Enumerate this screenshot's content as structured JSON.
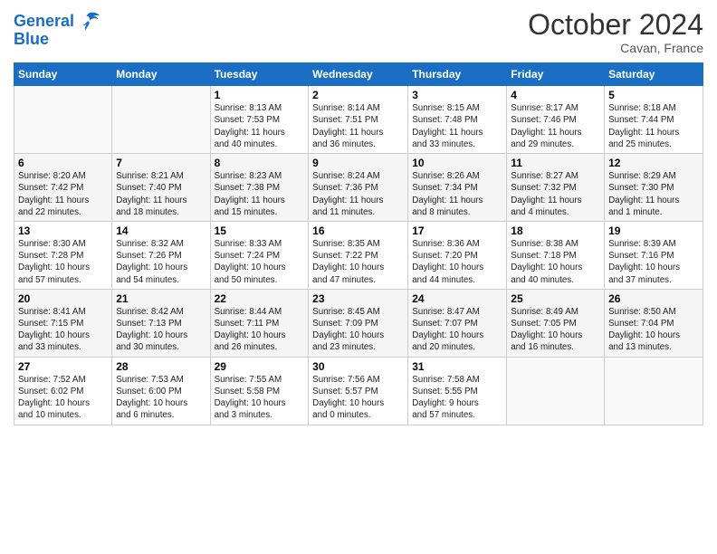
{
  "header": {
    "logo_line1": "General",
    "logo_line2": "Blue",
    "month": "October 2024",
    "location": "Cavan, France"
  },
  "weekdays": [
    "Sunday",
    "Monday",
    "Tuesday",
    "Wednesday",
    "Thursday",
    "Friday",
    "Saturday"
  ],
  "weeks": [
    [
      {
        "day": "",
        "detail": ""
      },
      {
        "day": "",
        "detail": ""
      },
      {
        "day": "1",
        "detail": "Sunrise: 8:13 AM\nSunset: 7:53 PM\nDaylight: 11 hours\nand 40 minutes."
      },
      {
        "day": "2",
        "detail": "Sunrise: 8:14 AM\nSunset: 7:51 PM\nDaylight: 11 hours\nand 36 minutes."
      },
      {
        "day": "3",
        "detail": "Sunrise: 8:15 AM\nSunset: 7:48 PM\nDaylight: 11 hours\nand 33 minutes."
      },
      {
        "day": "4",
        "detail": "Sunrise: 8:17 AM\nSunset: 7:46 PM\nDaylight: 11 hours\nand 29 minutes."
      },
      {
        "day": "5",
        "detail": "Sunrise: 8:18 AM\nSunset: 7:44 PM\nDaylight: 11 hours\nand 25 minutes."
      }
    ],
    [
      {
        "day": "6",
        "detail": "Sunrise: 8:20 AM\nSunset: 7:42 PM\nDaylight: 11 hours\nand 22 minutes."
      },
      {
        "day": "7",
        "detail": "Sunrise: 8:21 AM\nSunset: 7:40 PM\nDaylight: 11 hours\nand 18 minutes."
      },
      {
        "day": "8",
        "detail": "Sunrise: 8:23 AM\nSunset: 7:38 PM\nDaylight: 11 hours\nand 15 minutes."
      },
      {
        "day": "9",
        "detail": "Sunrise: 8:24 AM\nSunset: 7:36 PM\nDaylight: 11 hours\nand 11 minutes."
      },
      {
        "day": "10",
        "detail": "Sunrise: 8:26 AM\nSunset: 7:34 PM\nDaylight: 11 hours\nand 8 minutes."
      },
      {
        "day": "11",
        "detail": "Sunrise: 8:27 AM\nSunset: 7:32 PM\nDaylight: 11 hours\nand 4 minutes."
      },
      {
        "day": "12",
        "detail": "Sunrise: 8:29 AM\nSunset: 7:30 PM\nDaylight: 11 hours\nand 1 minute."
      }
    ],
    [
      {
        "day": "13",
        "detail": "Sunrise: 8:30 AM\nSunset: 7:28 PM\nDaylight: 10 hours\nand 57 minutes."
      },
      {
        "day": "14",
        "detail": "Sunrise: 8:32 AM\nSunset: 7:26 PM\nDaylight: 10 hours\nand 54 minutes."
      },
      {
        "day": "15",
        "detail": "Sunrise: 8:33 AM\nSunset: 7:24 PM\nDaylight: 10 hours\nand 50 minutes."
      },
      {
        "day": "16",
        "detail": "Sunrise: 8:35 AM\nSunset: 7:22 PM\nDaylight: 10 hours\nand 47 minutes."
      },
      {
        "day": "17",
        "detail": "Sunrise: 8:36 AM\nSunset: 7:20 PM\nDaylight: 10 hours\nand 44 minutes."
      },
      {
        "day": "18",
        "detail": "Sunrise: 8:38 AM\nSunset: 7:18 PM\nDaylight: 10 hours\nand 40 minutes."
      },
      {
        "day": "19",
        "detail": "Sunrise: 8:39 AM\nSunset: 7:16 PM\nDaylight: 10 hours\nand 37 minutes."
      }
    ],
    [
      {
        "day": "20",
        "detail": "Sunrise: 8:41 AM\nSunset: 7:15 PM\nDaylight: 10 hours\nand 33 minutes."
      },
      {
        "day": "21",
        "detail": "Sunrise: 8:42 AM\nSunset: 7:13 PM\nDaylight: 10 hours\nand 30 minutes."
      },
      {
        "day": "22",
        "detail": "Sunrise: 8:44 AM\nSunset: 7:11 PM\nDaylight: 10 hours\nand 26 minutes."
      },
      {
        "day": "23",
        "detail": "Sunrise: 8:45 AM\nSunset: 7:09 PM\nDaylight: 10 hours\nand 23 minutes."
      },
      {
        "day": "24",
        "detail": "Sunrise: 8:47 AM\nSunset: 7:07 PM\nDaylight: 10 hours\nand 20 minutes."
      },
      {
        "day": "25",
        "detail": "Sunrise: 8:49 AM\nSunset: 7:05 PM\nDaylight: 10 hours\nand 16 minutes."
      },
      {
        "day": "26",
        "detail": "Sunrise: 8:50 AM\nSunset: 7:04 PM\nDaylight: 10 hours\nand 13 minutes."
      }
    ],
    [
      {
        "day": "27",
        "detail": "Sunrise: 7:52 AM\nSunset: 6:02 PM\nDaylight: 10 hours\nand 10 minutes."
      },
      {
        "day": "28",
        "detail": "Sunrise: 7:53 AM\nSunset: 6:00 PM\nDaylight: 10 hours\nand 6 minutes."
      },
      {
        "day": "29",
        "detail": "Sunrise: 7:55 AM\nSunset: 5:58 PM\nDaylight: 10 hours\nand 3 minutes."
      },
      {
        "day": "30",
        "detail": "Sunrise: 7:56 AM\nSunset: 5:57 PM\nDaylight: 10 hours\nand 0 minutes."
      },
      {
        "day": "31",
        "detail": "Sunrise: 7:58 AM\nSunset: 5:55 PM\nDaylight: 9 hours\nand 57 minutes."
      },
      {
        "day": "",
        "detail": ""
      },
      {
        "day": "",
        "detail": ""
      }
    ]
  ]
}
